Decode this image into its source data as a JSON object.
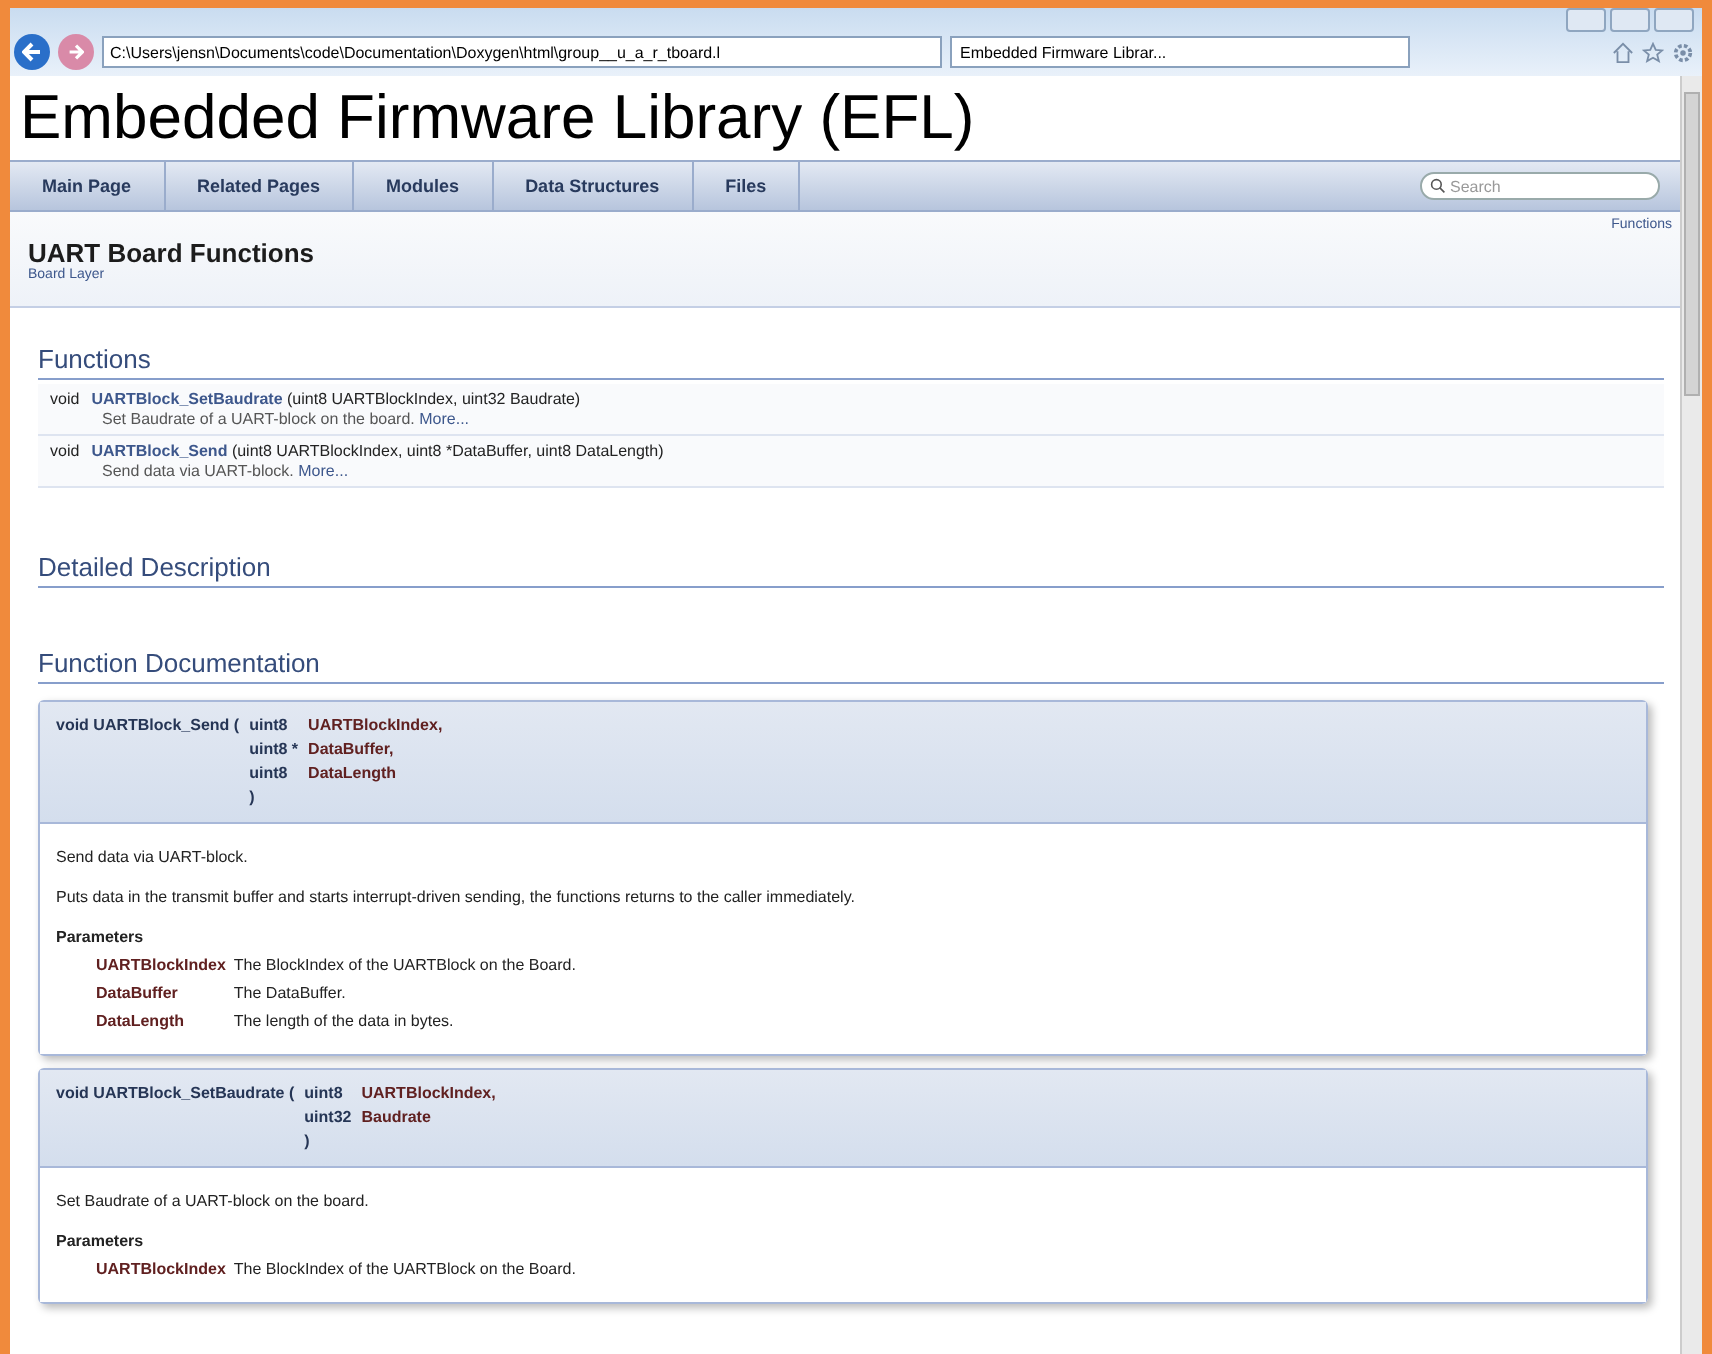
{
  "browser": {
    "address": "C:\\Users\\jensn\\Documents\\code\\Documentation\\Doxygen\\html\\group__u_a_r_tboard.l",
    "tab_title": "Embedded Firmware Librar..."
  },
  "project_title": "Embedded Firmware Library (EFL)",
  "nav": [
    {
      "label": "Main Page",
      "selected": false
    },
    {
      "label": "Related Pages",
      "selected": false
    },
    {
      "label": "Modules",
      "selected": false
    },
    {
      "label": "Data Structures",
      "selected": false
    },
    {
      "label": "Files",
      "selected": false
    }
  ],
  "search": {
    "placeholder": "Search"
  },
  "header": {
    "title": "UART Board Functions",
    "group": "Board Layer",
    "summary_link": "Functions"
  },
  "functions": {
    "heading": "Functions",
    "members": [
      {
        "ret": "void",
        "name": "UARTBlock_SetBaudrate",
        "args": "(uint8 UARTBlockIndex, uint32 Baudrate)",
        "brief": "Set Baudrate of a UART-block on the board.",
        "more": "More..."
      },
      {
        "ret": "void",
        "name": "UARTBlock_Send",
        "args": "(uint8 UARTBlockIndex, uint8 *DataBuffer, uint8 DataLength)",
        "brief": "Send data via UART-block.",
        "more": "More..."
      }
    ]
  },
  "detailed_heading": "Detailed Description",
  "doc_heading": "Function Documentation",
  "memdocs": [
    {
      "signature": "void UARTBlock_Send",
      "open": "(",
      "close": ")",
      "params": [
        {
          "type": "uint8",
          "name": "UARTBlockIndex,"
        },
        {
          "type": "uint8 *",
          "name": "DataBuffer,"
        },
        {
          "type": "uint8",
          "name": "DataLength"
        }
      ],
      "paragraphs": [
        "Send data via UART-block.",
        "Puts data in the transmit buffer and starts interrupt-driven sending, the functions returns to the caller immediately."
      ],
      "params_title": "Parameters",
      "param_docs": [
        {
          "name": "UARTBlockIndex",
          "desc": "The BlockIndex of the UARTBlock on the Board."
        },
        {
          "name": "DataBuffer",
          "desc": "The DataBuffer."
        },
        {
          "name": "DataLength",
          "desc": "The length of the data in bytes."
        }
      ]
    },
    {
      "signature": "void UARTBlock_SetBaudrate",
      "open": "(",
      "close": ")",
      "params": [
        {
          "type": "uint8",
          "name": "UARTBlockIndex,"
        },
        {
          "type": "uint32",
          "name": "Baudrate"
        }
      ],
      "paragraphs": [
        "Set Baudrate of a UART-block on the board."
      ],
      "params_title": "Parameters",
      "param_docs": [
        {
          "name": "UARTBlockIndex",
          "desc": "The BlockIndex of the UARTBlock on the Board."
        }
      ]
    }
  ]
}
